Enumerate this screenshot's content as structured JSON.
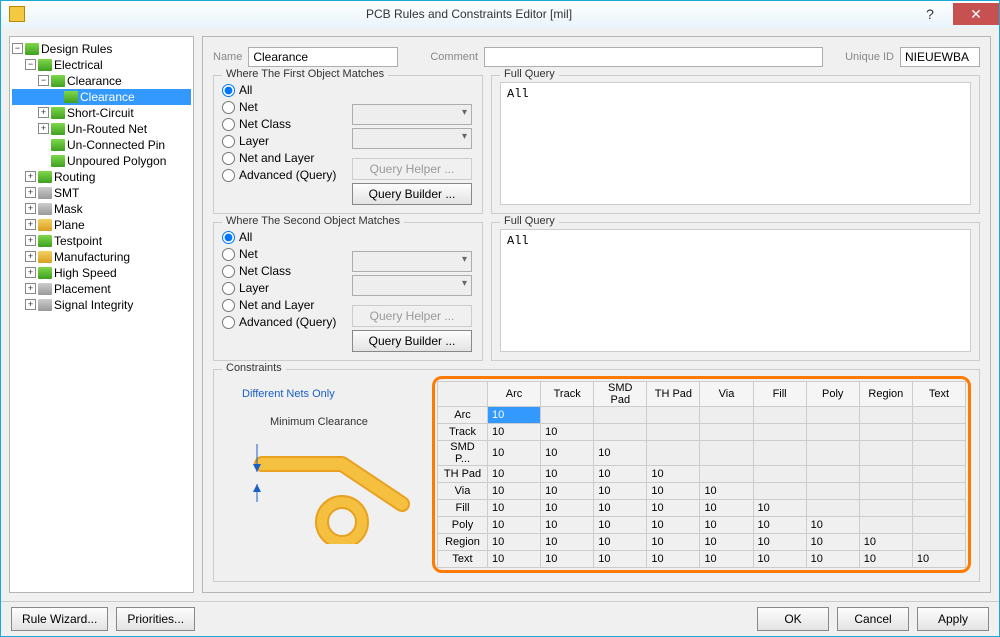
{
  "window": {
    "title": "PCB Rules and Constraints Editor [mil]"
  },
  "tree": {
    "root": "Design Rules",
    "items": [
      {
        "label": "Electrical",
        "children": [
          {
            "label": "Clearance",
            "children": [
              {
                "label": "Clearance",
                "selected": true
              }
            ]
          },
          {
            "label": "Short-Circuit"
          },
          {
            "label": "Un-Routed Net"
          },
          {
            "label": "Un-Connected Pin"
          },
          {
            "label": "Unpoured Polygon"
          }
        ]
      },
      {
        "label": "Routing"
      },
      {
        "label": "SMT"
      },
      {
        "label": "Mask"
      },
      {
        "label": "Plane"
      },
      {
        "label": "Testpoint"
      },
      {
        "label": "Manufacturing"
      },
      {
        "label": "High Speed"
      },
      {
        "label": "Placement"
      },
      {
        "label": "Signal Integrity"
      }
    ]
  },
  "fields": {
    "name_label": "Name",
    "name_value": "Clearance",
    "comment_label": "Comment",
    "comment_value": "",
    "uniqueid_label": "Unique ID",
    "uniqueid_value": "NIEUEWBA"
  },
  "match1": {
    "title": "Where The First Object Matches",
    "options": [
      "All",
      "Net",
      "Net Class",
      "Layer",
      "Net and Layer",
      "Advanced (Query)"
    ],
    "selected": "All",
    "query_helper": "Query Helper ...",
    "query_builder": "Query Builder ...",
    "full_query_label": "Full Query",
    "full_query_value": "All"
  },
  "match2": {
    "title": "Where The Second Object Matches",
    "options": [
      "All",
      "Net",
      "Net Class",
      "Layer",
      "Net and Layer",
      "Advanced (Query)"
    ],
    "selected": "All",
    "query_helper": "Query Helper ...",
    "query_builder": "Query Builder ...",
    "full_query_label": "Full Query",
    "full_query_value": "All"
  },
  "constraints": {
    "title": "Constraints",
    "diff_nets": "Different Nets Only",
    "min_clearance": "Minimum Clearance",
    "headers": [
      "Arc",
      "Track",
      "SMD Pad",
      "TH Pad",
      "Via",
      "Fill",
      "Poly",
      "Region",
      "Text"
    ],
    "row_headers": [
      "Arc",
      "Track",
      "SMD P...",
      "TH Pad",
      "Via",
      "Fill",
      "Poly",
      "Region",
      "Text"
    ],
    "selected_cell": "10",
    "value": "10"
  },
  "footer": {
    "rule_wizard": "Rule Wizard...",
    "priorities": "Priorities...",
    "ok": "OK",
    "cancel": "Cancel",
    "apply": "Apply"
  }
}
